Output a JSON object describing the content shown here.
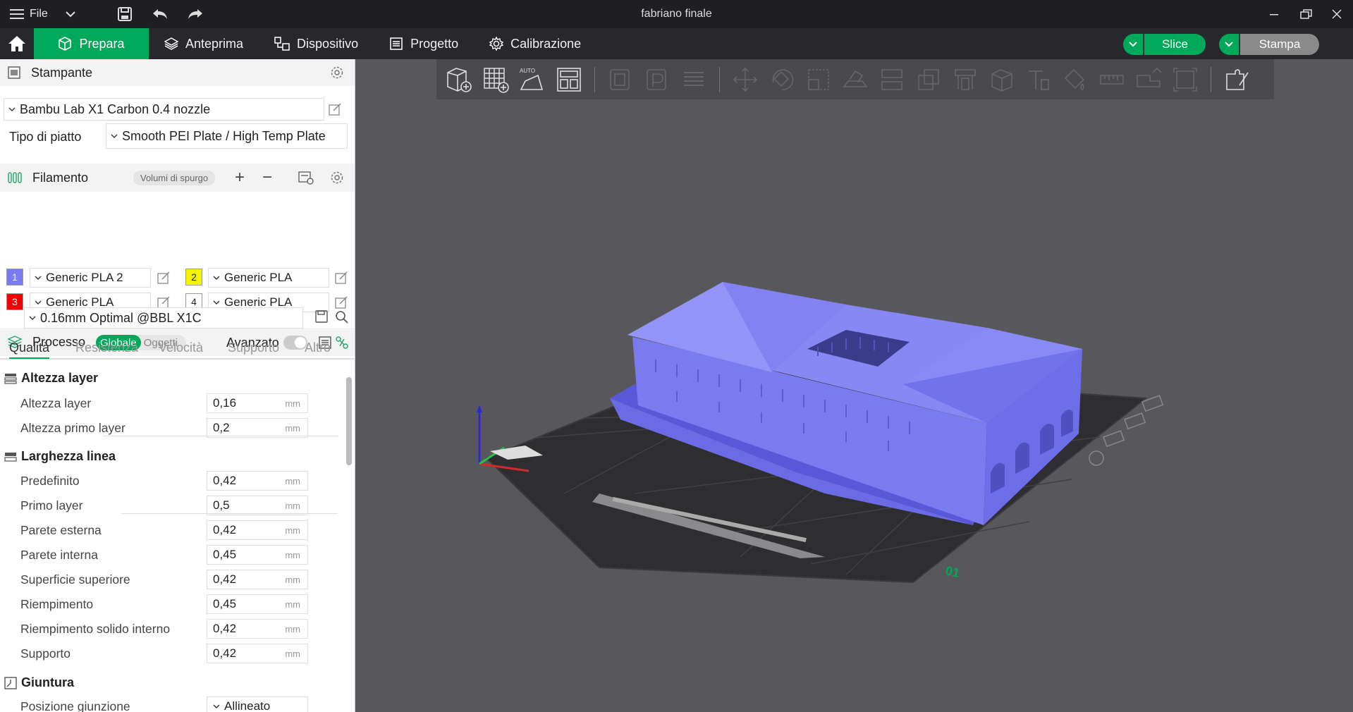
{
  "window": {
    "title": "fabriano finale",
    "file_menu": "File"
  },
  "tabs": [
    {
      "label": "Prepara",
      "icon": "cube-icon"
    },
    {
      "label": "Anteprima",
      "icon": "layers-icon"
    },
    {
      "label": "Dispositivo",
      "icon": "device-icon"
    },
    {
      "label": "Progetto",
      "icon": "project-icon"
    },
    {
      "label": "Calibrazione",
      "icon": "calibration-icon"
    }
  ],
  "actions": {
    "slice": "Slice",
    "print": "Stampa"
  },
  "printer": {
    "section_title": "Stampante",
    "model": "Bambu Lab X1 Carbon 0.4 nozzle",
    "plate_label": "Tipo di piatto",
    "plate_value": "Smooth PEI Plate / High Temp Plate"
  },
  "filament": {
    "section_title": "Filamento",
    "purge_button": "Volumi di spurgo",
    "slots": [
      {
        "num": "1",
        "name": "Generic PLA 2",
        "color": "#7b7bf0"
      },
      {
        "num": "2",
        "name": "Generic PLA",
        "color": "#f5f500"
      },
      {
        "num": "3",
        "name": "Generic PLA",
        "color": "#f00000"
      },
      {
        "num": "4",
        "name": "Generic PLA",
        "color": "#ffffff"
      }
    ]
  },
  "process": {
    "section_title": "Processo",
    "global": "Globale",
    "objects": "Oggetti",
    "advanced": "Avanzato",
    "preset": "0.16mm Optimal @BBL X1C",
    "subtabs": [
      "Qualità",
      "Resistenza",
      "Velocità",
      "Supporto",
      "Altro"
    ],
    "groups": {
      "layer_height": {
        "title": "Altezza layer",
        "rows": [
          {
            "label": "Altezza layer",
            "value": "0,16",
            "unit": "mm"
          },
          {
            "label": "Altezza primo layer",
            "value": "0,2",
            "unit": "mm"
          }
        ]
      },
      "line_width": {
        "title": "Larghezza linea",
        "rows": [
          {
            "label": "Predefinito",
            "value": "0,42",
            "unit": "mm"
          },
          {
            "label": "Primo layer",
            "value": "0,5",
            "unit": "mm"
          },
          {
            "label": "Parete esterna",
            "value": "0,42",
            "unit": "mm"
          },
          {
            "label": "Parete interna",
            "value": "0,45",
            "unit": "mm"
          },
          {
            "label": "Superficie superiore",
            "value": "0,42",
            "unit": "mm"
          },
          {
            "label": "Riempimento",
            "value": "0,45",
            "unit": "mm"
          },
          {
            "label": "Riempimento solido interno",
            "value": "0,42",
            "unit": "mm"
          },
          {
            "label": "Supporto",
            "value": "0,42",
            "unit": "mm"
          }
        ]
      },
      "seam": {
        "title": "Giuntura",
        "rows": [
          {
            "label": "Posizione giunzione",
            "value": "Allineato"
          }
        ]
      }
    }
  },
  "viewport": {
    "plate_number": "01",
    "model_color": "#7b7bf0"
  }
}
